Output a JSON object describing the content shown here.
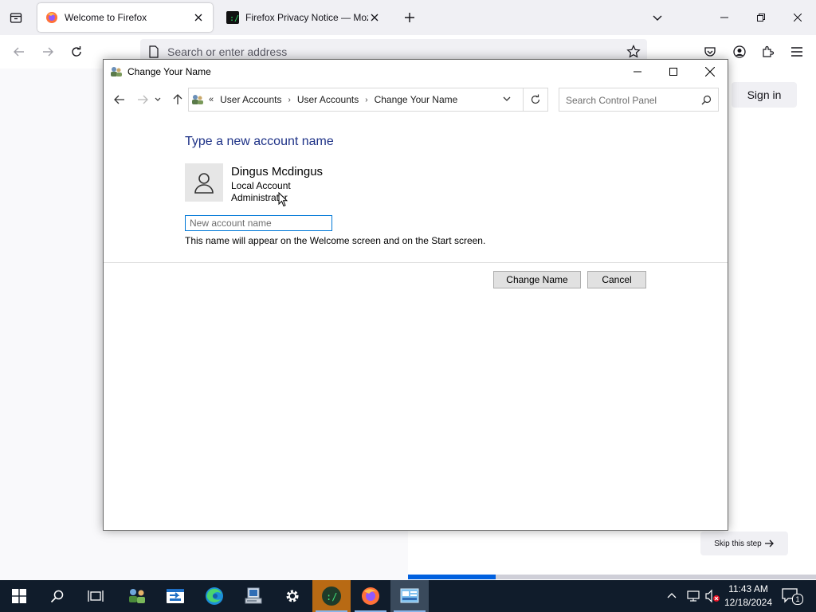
{
  "browser": {
    "tabs": [
      {
        "label": "Welcome to Firefox",
        "active": true
      },
      {
        "label": "Firefox Privacy Notice — Mozill",
        "active": false
      }
    ],
    "url_placeholder": "Search or enter address"
  },
  "page": {
    "sign_in_label": "Sign in",
    "skip_label": "Skip this step",
    "progress_fraction": 0.215
  },
  "dialog": {
    "title": "Change Your Name",
    "breadcrumbs": [
      "User Accounts",
      "User Accounts",
      "Change Your Name"
    ],
    "search_placeholder": "Search Control Panel",
    "heading": "Type a new account name",
    "user_name": "Dingus Mcdingus",
    "account_type": "Local Account",
    "account_role": "Administrator",
    "input_placeholder": "New account name",
    "hint": "This name will appear on the Welcome screen and on the Start screen.",
    "change_label": "Change Name",
    "cancel_label": "Cancel"
  },
  "taskbar": {
    "items": [
      "start-icon",
      "search-icon",
      "task-view-icon",
      "network-people-icon",
      "remote-app-icon",
      "edge-icon",
      "computer-icon",
      "settings-icon",
      "terminal-icon",
      "firefox-icon",
      "control-panel-icon"
    ],
    "time": "11:43 AM",
    "date": "12/18/2024",
    "notification_count": "1"
  },
  "colors": {
    "heading": "#1e3287",
    "accent": "#0078d7",
    "firefox_progress": "#0060df",
    "taskbar": "#101c2b"
  }
}
